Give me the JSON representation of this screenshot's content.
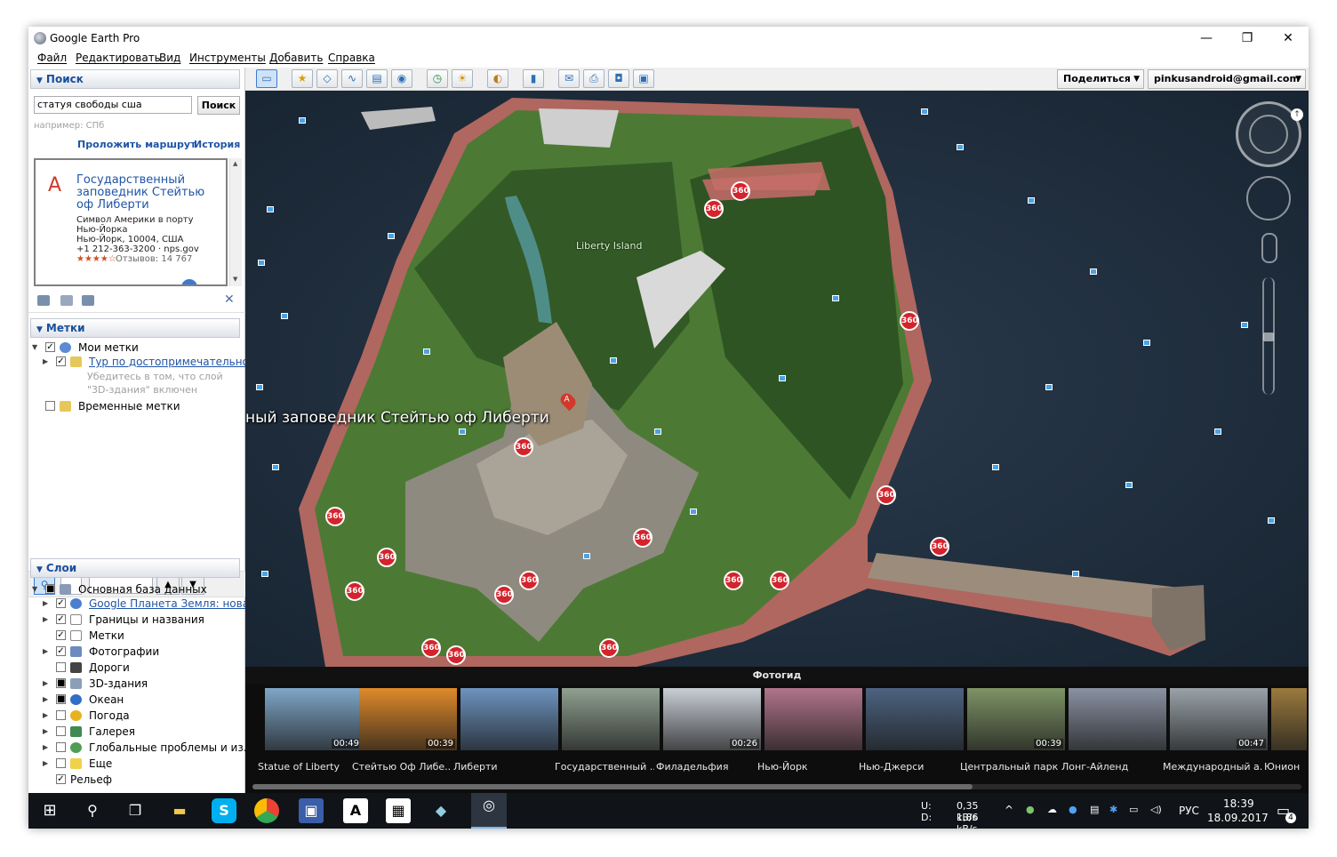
{
  "window": {
    "title": "Google Earth Pro",
    "controls": {
      "minimize": "—",
      "restore": "❐",
      "close": "✕"
    }
  },
  "menu": [
    "Файл",
    "Редактировать",
    "Вид",
    "Инструменты",
    "Добавить",
    "Справка"
  ],
  "toolbar": {
    "share_label": "Поделиться",
    "account_label": "pinkusandroid@gmail.com"
  },
  "search": {
    "header": "Поиск",
    "query": "статуя свободы сша",
    "button": "Поиск",
    "hint": "например: СПб",
    "route_link": "Проложить маршрут",
    "history_link": "История",
    "result": {
      "marker": "A",
      "title": "Государственный заповедник Стейтью оф Либерти",
      "line1": "Символ Америки в порту",
      "line2": "Нью-Йорка",
      "line3": "Нью-Йорк, 10004, США",
      "line4": "+1 212-363-3200 · nps.gov",
      "stars": "★★★★☆",
      "reviews": "Отзывов: 14 767"
    }
  },
  "places": {
    "header": "Метки",
    "my_places": "Мои метки",
    "tour_link": "Тур по достопримечательностям",
    "note": "Убедитесь в том, что слой \"3D-здания\" включен",
    "temp": "Временные метки"
  },
  "layers": {
    "header": "Слои",
    "items": [
      "Основная база данных",
      "Google Планета Земля: новая версия",
      "Границы и названия",
      "Метки",
      "Фотографии",
      "Дороги",
      "3D-здания",
      "Океан",
      "Погода",
      "Галерея",
      "Глобальные проблемы и из...",
      "Еще",
      "Рельеф"
    ]
  },
  "map": {
    "label_main": "ный заповедник Стейтью оф Либерти",
    "label_island": "Liberty Island",
    "marker": "A",
    "badge": "360"
  },
  "tour": {
    "header": "Фотогид",
    "items": [
      {
        "caption": "Statue of Liberty",
        "duration": "00:49",
        "color": "#7fa6c8"
      },
      {
        "caption": "Стейтью Оф Либе...",
        "duration": "00:39",
        "color": "#e08a2a"
      },
      {
        "caption": "Либерти",
        "duration": "",
        "color": "#6d93bf"
      },
      {
        "caption": "Государственный ...",
        "duration": "",
        "color": "#8fa090"
      },
      {
        "caption": "Филадельфия",
        "duration": "00:26",
        "color": "#c9cfd6"
      },
      {
        "caption": "Нью-Йорк",
        "duration": "",
        "color": "#b0758a"
      },
      {
        "caption": "Нью-Джерси",
        "duration": "",
        "color": "#4d6380"
      },
      {
        "caption": "Центральный парк",
        "duration": "00:39",
        "color": "#7e9466"
      },
      {
        "caption": "Лонг-Айленд",
        "duration": "",
        "color": "#8a92a2"
      },
      {
        "caption": "Международный а...",
        "duration": "00:47",
        "color": "#9aa3a9"
      },
      {
        "caption": "Юнион",
        "duration": "",
        "color": "#9b7a3e"
      }
    ]
  },
  "taskbar": {
    "net_up_label": "U:",
    "net_down_label": "D:",
    "net_up": "0,35 kB/s",
    "net_down": "1,86 kB/s",
    "lang": "РУС",
    "time": "18:39",
    "date": "18.09.2017",
    "notifications": "4"
  }
}
